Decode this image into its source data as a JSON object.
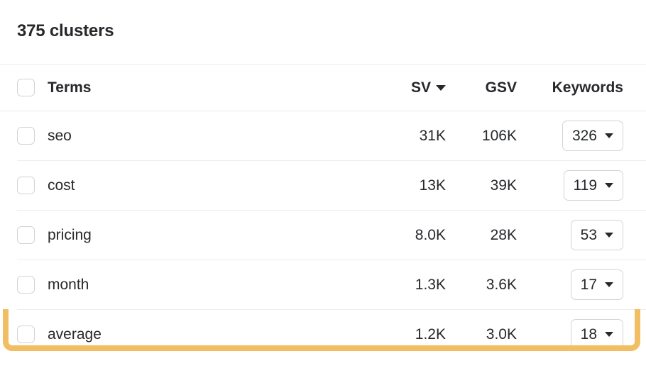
{
  "panel": {
    "title": "375 clusters"
  },
  "table": {
    "columns": {
      "terms": "Terms",
      "sv": "SV",
      "gsv": "GSV",
      "keywords": "Keywords"
    },
    "sort": {
      "column": "SV",
      "direction": "desc",
      "icon": "caret-down-icon"
    },
    "rows": [
      {
        "term": "seo",
        "sv": "31K",
        "gsv": "106K",
        "keywords": "326",
        "highlighted": false
      },
      {
        "term": "cost",
        "sv": "13K",
        "gsv": "39K",
        "keywords": "119",
        "highlighted": false
      },
      {
        "term": "pricing",
        "sv": "8.0K",
        "gsv": "28K",
        "keywords": "53",
        "highlighted": false
      },
      {
        "term": "month",
        "sv": "1.3K",
        "gsv": "3.6K",
        "keywords": "17",
        "highlighted": true
      },
      {
        "term": "average",
        "sv": "1.2K",
        "gsv": "3.0K",
        "keywords": "18",
        "highlighted": false
      }
    ]
  },
  "colors": {
    "highlight": "#f2be63",
    "text": "#26282b",
    "divider": "#eceded",
    "control_border": "#d2d4d6"
  }
}
